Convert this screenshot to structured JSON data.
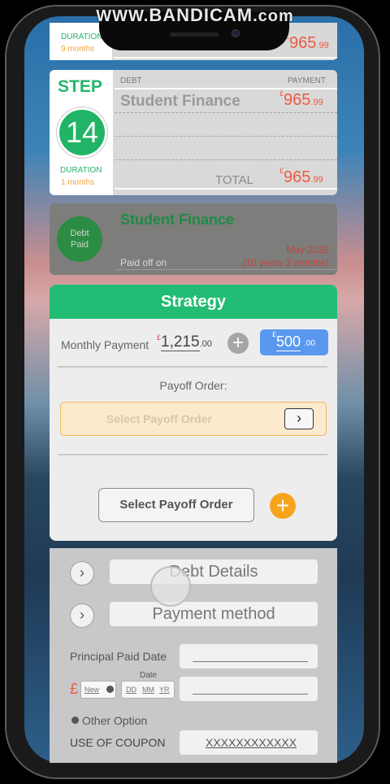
{
  "watermark": {
    "prefix": "WWW.",
    "brand": "BANDICAM",
    "suffix": ".com"
  },
  "step_prev": {
    "duration_label": "DURATION",
    "duration_value": "9 months",
    "amount_symbol": "£",
    "amount": "965",
    "amount_dec": ".99"
  },
  "step_current": {
    "step_label": "STEP",
    "step_number": "14",
    "debt_header": "DEBT",
    "payment_header": "PAYMENT",
    "debt_name": "Student Finance",
    "amount_symbol": "£",
    "amount": "965",
    "amount_dec": ".99",
    "duration_label": "DURATION",
    "duration_value": "1 months",
    "total_label": "TOTAL",
    "total_symbol": "£",
    "total": "965",
    "total_dec": ".99"
  },
  "paid_card": {
    "badge_line1": "Debt",
    "badge_line2": "Paid",
    "debt_name": "Student Finance",
    "paid_off_label": "Paid off on",
    "paid_date": "May 2032",
    "paid_duration": "(10 years 3 months)"
  },
  "strategy": {
    "title": "Strategy",
    "monthly_payment_label": "Monthly Payment",
    "monthly_symbol": "£",
    "monthly_amount": "1,215",
    "monthly_dec": ".00",
    "extra_symbol": "£",
    "extra_amount": "500",
    "extra_dec": ".00",
    "payoff_order_label": "Payoff Order:",
    "select_placeholder": "Select Payoff Order",
    "select_button": "Select Payoff Order"
  },
  "details": {
    "debt_details": "Debt Details",
    "payment_method": "Payment method",
    "principal_paid_date": "Principal Paid Date",
    "currency_symbol": "£",
    "new_label": "New",
    "date_label": "Date",
    "dd": "DD",
    "mm": "MM",
    "yr": "YR",
    "other_option": "Other Option",
    "use_of_coupon": "USE OF COUPON",
    "coupon_value": "XXXXXXXXXXXX"
  },
  "colors": {
    "green": "#23bc74",
    "orange": "#f7a41d",
    "blue": "#5a98ef",
    "red": "#ec5a43"
  }
}
